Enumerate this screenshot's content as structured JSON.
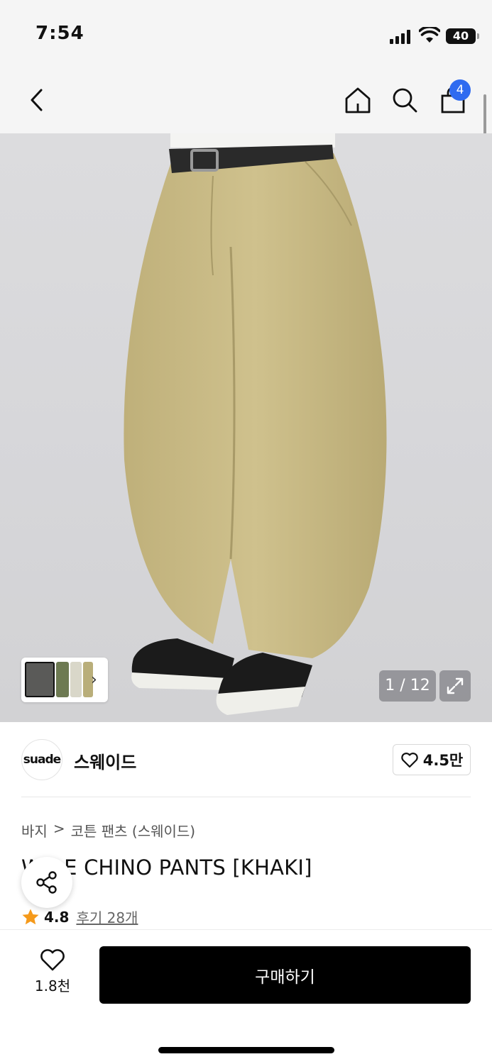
{
  "status_bar": {
    "time": "7:54",
    "battery": "40"
  },
  "nav": {
    "cart_count": "4",
    "icons": [
      "back-chevron",
      "home",
      "search",
      "shopping-bag"
    ]
  },
  "gallery": {
    "counter": "1 / 12",
    "thumbnail_colors": [
      "#5a5a58",
      "#6d7a52",
      "#d9d7c9",
      "#b9ae7a"
    ]
  },
  "brand": {
    "logo_text": "suade",
    "name": "스웨이드",
    "likes": "4.5만"
  },
  "breadcrumb": {
    "category": "바지",
    "separator": ">",
    "subcategory": "코튼 팬츠 (스웨이드)"
  },
  "product": {
    "title": "WIDE CHINO PANTS [KHAKI]",
    "rating": "4.8",
    "reviews": "후기 28개"
  },
  "bottom_bar": {
    "wish_count": "1.8천",
    "buy_label": "구매하기"
  },
  "colors": {
    "accent_blue": "#2f6bf0",
    "star": "#f59a1b",
    "pants": "#c9bb86"
  }
}
